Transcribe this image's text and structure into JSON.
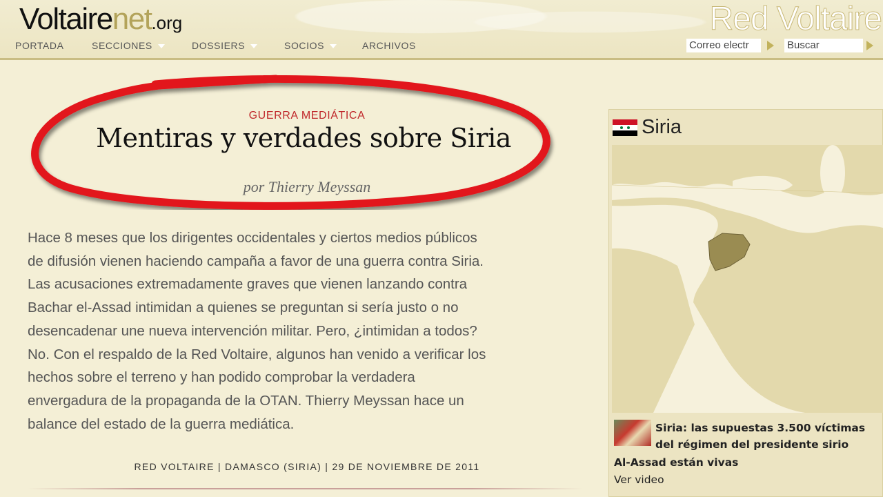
{
  "header": {
    "logo_part1": "Voltaire",
    "logo_part2": "net",
    "logo_part3": ".org",
    "brand_right": "Red Voltaire",
    "nav": [
      {
        "label": "PORTADA",
        "dropdown": false
      },
      {
        "label": "SECCIONES",
        "dropdown": true
      },
      {
        "label": "DOSSIERS",
        "dropdown": true
      },
      {
        "label": "SOCIOS",
        "dropdown": true
      },
      {
        "label": "ARCHIVOS",
        "dropdown": false
      }
    ],
    "email_placeholder": "Correo electr",
    "search_placeholder": "Buscar"
  },
  "article": {
    "kicker": "GUERRA MEDIÁTICA",
    "title": "Mentiras y verdades sobre Siria",
    "byline": "por Thierry Meyssan",
    "lead_lines": [
      "Hace 8 meses que los dirigentes occidentales y ciertos medios públicos",
      "de difusión vienen haciendo campaña a favor de una guerra contra Siria.",
      "Las acusaciones extremadamente graves que vienen lanzando contra",
      "Bachar el-Assad intimidan a quienes se preguntan si sería justo o no",
      "desencadenar une nueva intervención militar. Pero, ¿intimidan a todos?",
      "No. Con el respaldo de la Red Voltaire, algunos han venido a verificar los",
      "hechos sobre el terreno y han podido comprobar la verdadera",
      "envergadura de la propaganda de la OTAN. Thierry Meyssan hace un",
      "balance del estado de la guerra mediática."
    ],
    "dateline": "RED VOLTAIRE | DAMASCO (SIRIA) | 29 DE NOVIEMBRE DE 2011"
  },
  "sidebar": {
    "title": "Siria",
    "caption_line1": "Siria: las supuestas 3.500 víctimas",
    "caption_line2": "del régimen del presidente sirio",
    "caption_line3": "Al-Assad están vivas",
    "link": "Ver video"
  },
  "colors": {
    "background": "#f4efd6",
    "accent_red": "#c0282b",
    "logo_gold": "#b3a35a",
    "map_land": "#e3d9ac",
    "map_sea": "#f6f1dc",
    "map_highlight": "#9a8c52"
  }
}
